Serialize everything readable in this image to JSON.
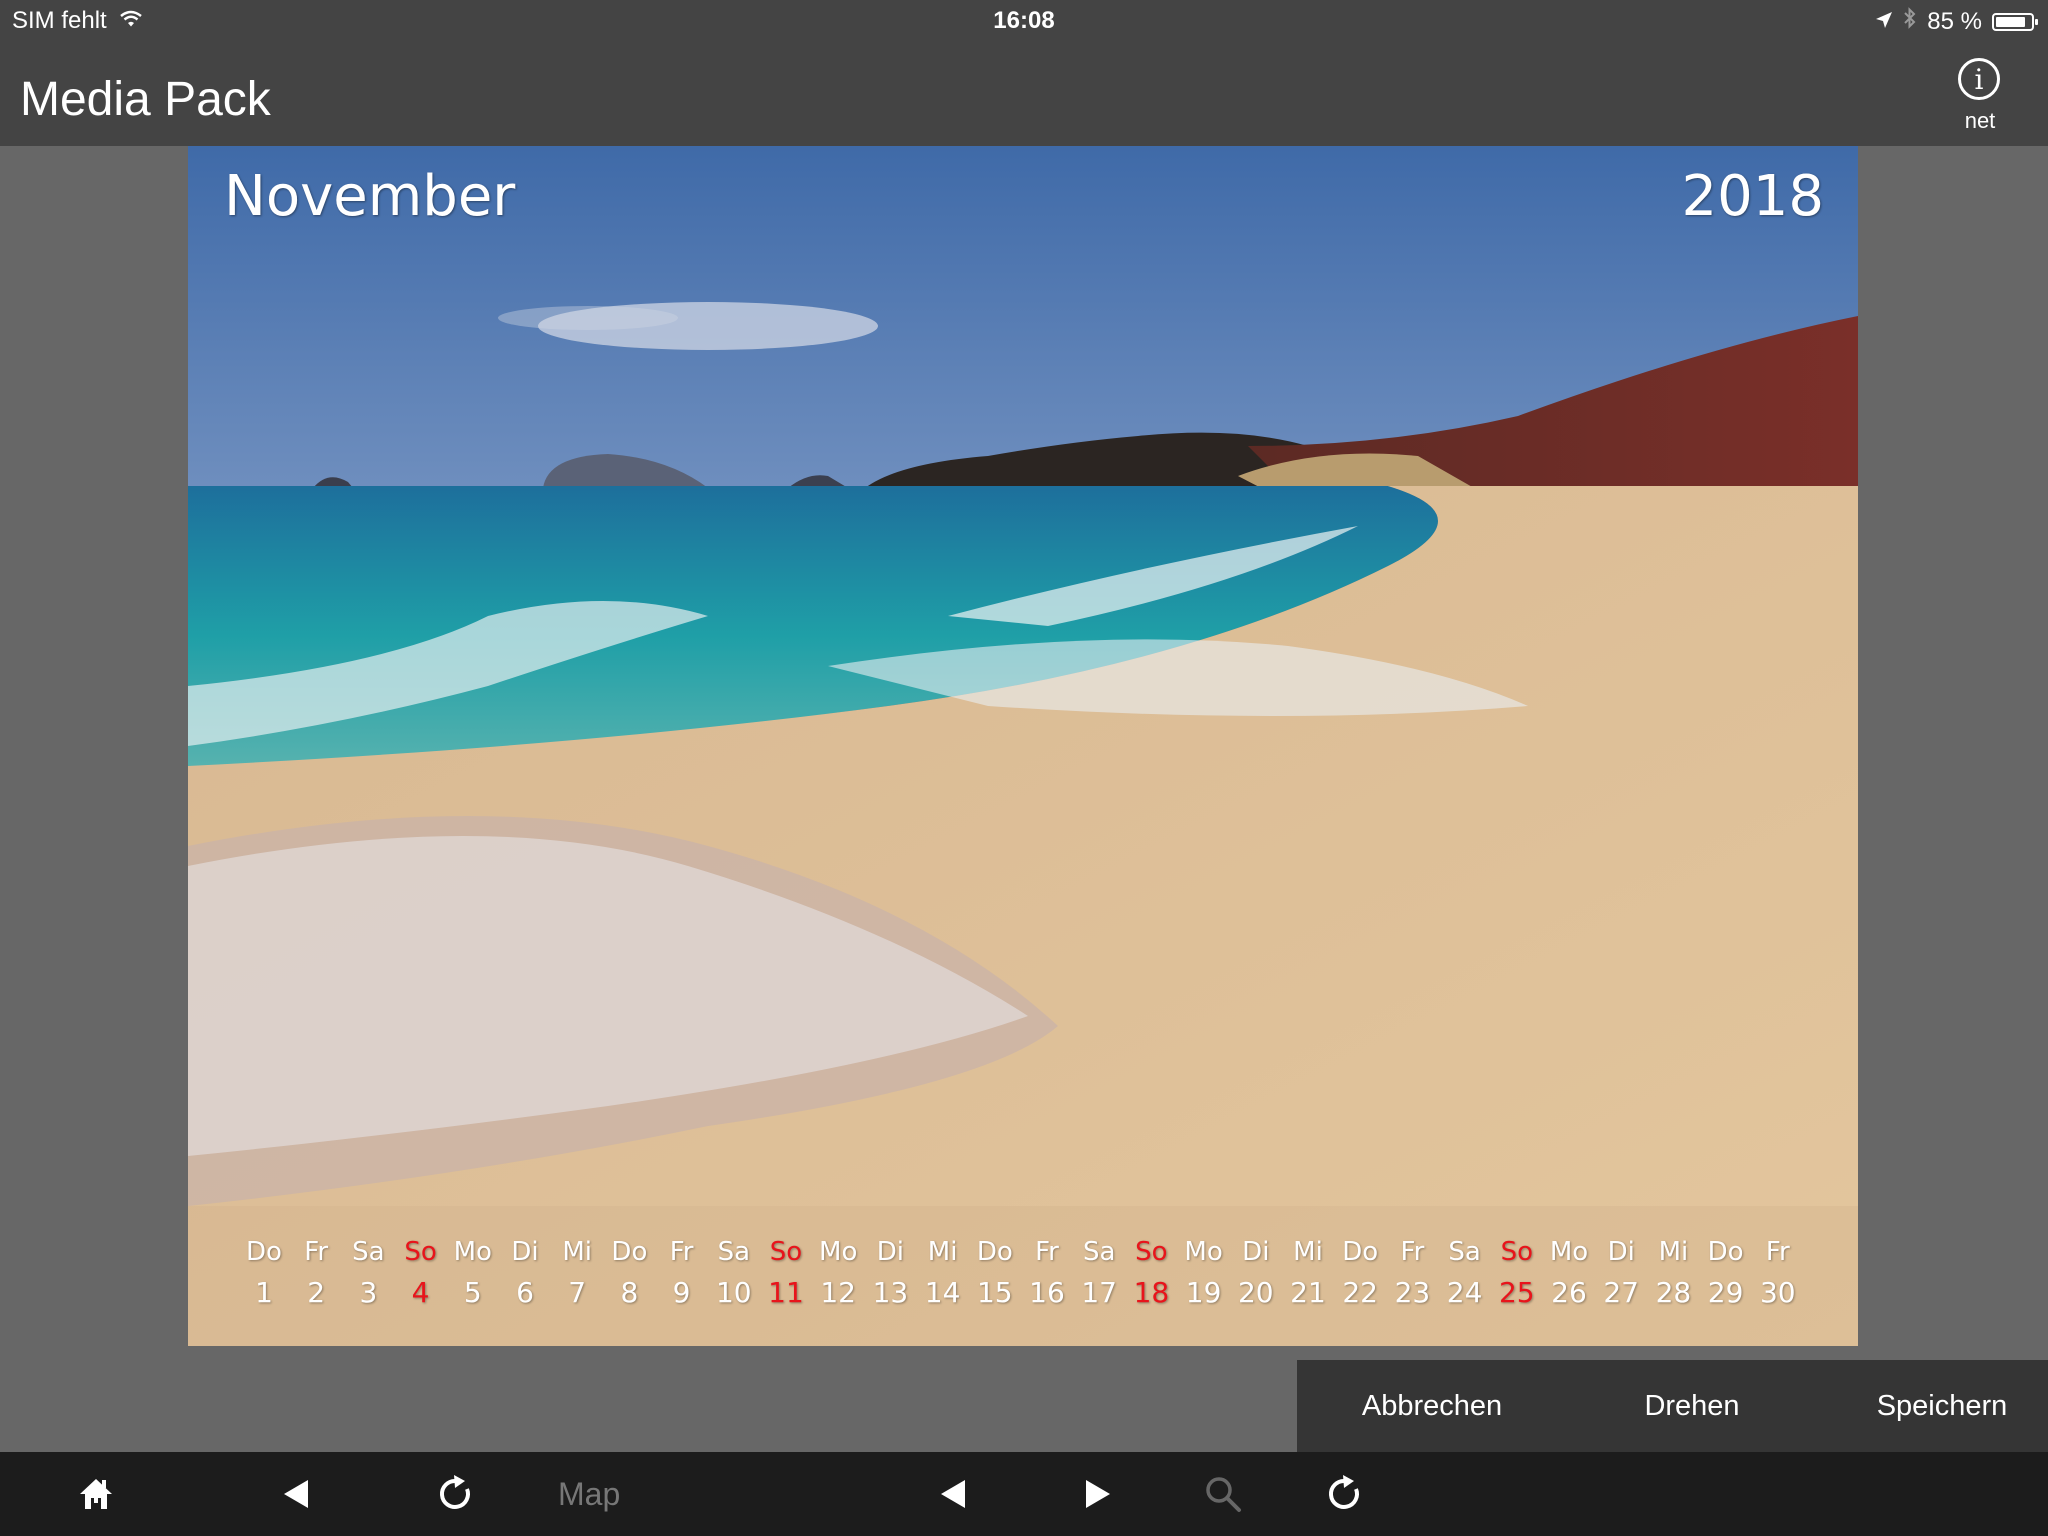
{
  "status_bar": {
    "carrier": "SIM fehlt",
    "time": "16:08",
    "battery_percent": "85 %",
    "battery_level": 0.85
  },
  "nav": {
    "title": "Media Pack",
    "info_label": "net",
    "info_glyph": "i"
  },
  "calendar": {
    "month": "November",
    "year": "2018",
    "days": [
      {
        "wd": "Do",
        "d": "1",
        "sunday": false
      },
      {
        "wd": "Fr",
        "d": "2",
        "sunday": false
      },
      {
        "wd": "Sa",
        "d": "3",
        "sunday": false
      },
      {
        "wd": "So",
        "d": "4",
        "sunday": true
      },
      {
        "wd": "Mo",
        "d": "5",
        "sunday": false
      },
      {
        "wd": "Di",
        "d": "6",
        "sunday": false
      },
      {
        "wd": "Mi",
        "d": "7",
        "sunday": false
      },
      {
        "wd": "Do",
        "d": "8",
        "sunday": false
      },
      {
        "wd": "Fr",
        "d": "9",
        "sunday": false
      },
      {
        "wd": "Sa",
        "d": "10",
        "sunday": false
      },
      {
        "wd": "So",
        "d": "11",
        "sunday": true
      },
      {
        "wd": "Mo",
        "d": "12",
        "sunday": false
      },
      {
        "wd": "Di",
        "d": "13",
        "sunday": false
      },
      {
        "wd": "Mi",
        "d": "14",
        "sunday": false
      },
      {
        "wd": "Do",
        "d": "15",
        "sunday": false
      },
      {
        "wd": "Fr",
        "d": "16",
        "sunday": false
      },
      {
        "wd": "Sa",
        "d": "17",
        "sunday": false
      },
      {
        "wd": "So",
        "d": "18",
        "sunday": true
      },
      {
        "wd": "Mo",
        "d": "19",
        "sunday": false
      },
      {
        "wd": "Di",
        "d": "20",
        "sunday": false
      },
      {
        "wd": "Mi",
        "d": "21",
        "sunday": false
      },
      {
        "wd": "Do",
        "d": "22",
        "sunday": false
      },
      {
        "wd": "Fr",
        "d": "23",
        "sunday": false
      },
      {
        "wd": "Sa",
        "d": "24",
        "sunday": false
      },
      {
        "wd": "So",
        "d": "25",
        "sunday": true
      },
      {
        "wd": "Mo",
        "d": "26",
        "sunday": false
      },
      {
        "wd": "Di",
        "d": "27",
        "sunday": false
      },
      {
        "wd": "Mi",
        "d": "28",
        "sunday": false
      },
      {
        "wd": "Do",
        "d": "29",
        "sunday": false
      },
      {
        "wd": "Fr",
        "d": "30",
        "sunday": false
      }
    ]
  },
  "actions": {
    "cancel": "Abbrechen",
    "rotate": "Drehen",
    "save": "Speichern"
  },
  "toolbar": {
    "map_label": "Map",
    "icons": [
      "home-icon",
      "back-icon",
      "refresh-icon",
      "map",
      "prev-icon",
      "next-icon",
      "search-icon",
      "reload-icon"
    ]
  },
  "colors": {
    "bar": "#444444",
    "background": "#676767",
    "action_bar": "#353535",
    "toolbar": "#1c1c1c",
    "sunday": "#e8141b"
  }
}
